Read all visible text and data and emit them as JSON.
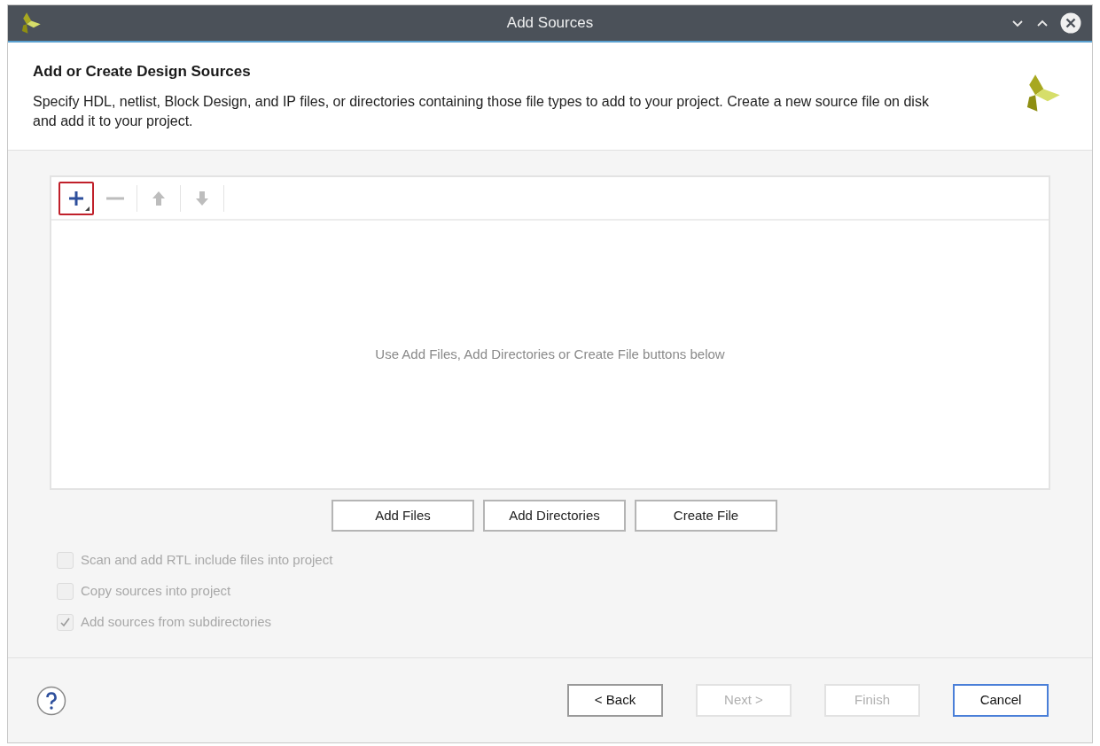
{
  "window": {
    "title": "Add Sources"
  },
  "header": {
    "title": "Add or Create Design Sources",
    "description": "Specify HDL, netlist, Block Design, and IP files, or directories containing those file types to add to your project. Create a new source file on disk and add it to your project."
  },
  "toolbar": [
    {
      "kind": "add",
      "disabled": false,
      "highlighted": true
    },
    {
      "kind": "remove",
      "disabled": true,
      "highlighted": false
    },
    {
      "kind": "up",
      "disabled": true,
      "highlighted": false
    },
    {
      "kind": "down",
      "disabled": true,
      "highlighted": false
    }
  ],
  "file_list": {
    "empty_message": "Use Add Files, Add Directories or Create File buttons below"
  },
  "actions": [
    "Add Files",
    "Add Directories",
    "Create File"
  ],
  "options": [
    {
      "label": "Scan and add RTL include files into project",
      "checked": false,
      "disabled": true
    },
    {
      "label": "Copy sources into project",
      "checked": false,
      "disabled": true
    },
    {
      "label": "Add sources from subdirectories",
      "checked": true,
      "disabled": true
    }
  ],
  "footer_buttons": [
    {
      "label": "< Back",
      "disabled": false,
      "focused": false
    },
    {
      "label": "Next >",
      "disabled": true,
      "focused": false
    },
    {
      "label": "Finish",
      "disabled": true,
      "focused": false
    },
    {
      "label": "Cancel",
      "disabled": false,
      "focused": true
    }
  ]
}
